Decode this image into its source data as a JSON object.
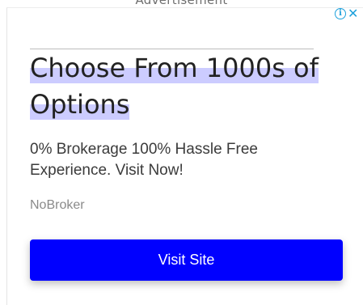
{
  "ad_label": "Advertisement",
  "ad": {
    "headline": "Choose From 1000s of Options",
    "description": "0% Brokerage 100% Hassle Free Experience. Visit Now!",
    "advertiser": "NoBroker",
    "cta_label": "Visit Site"
  },
  "ad_choices": {
    "info_icon": "info-icon",
    "info_glyph": "i",
    "close_icon": "close-icon",
    "close_glyph": "✕"
  },
  "colors": {
    "cta_background": "#0000ff",
    "headline_highlight": "#ccccff",
    "ad_choices_blue": "#1ea1dc"
  }
}
